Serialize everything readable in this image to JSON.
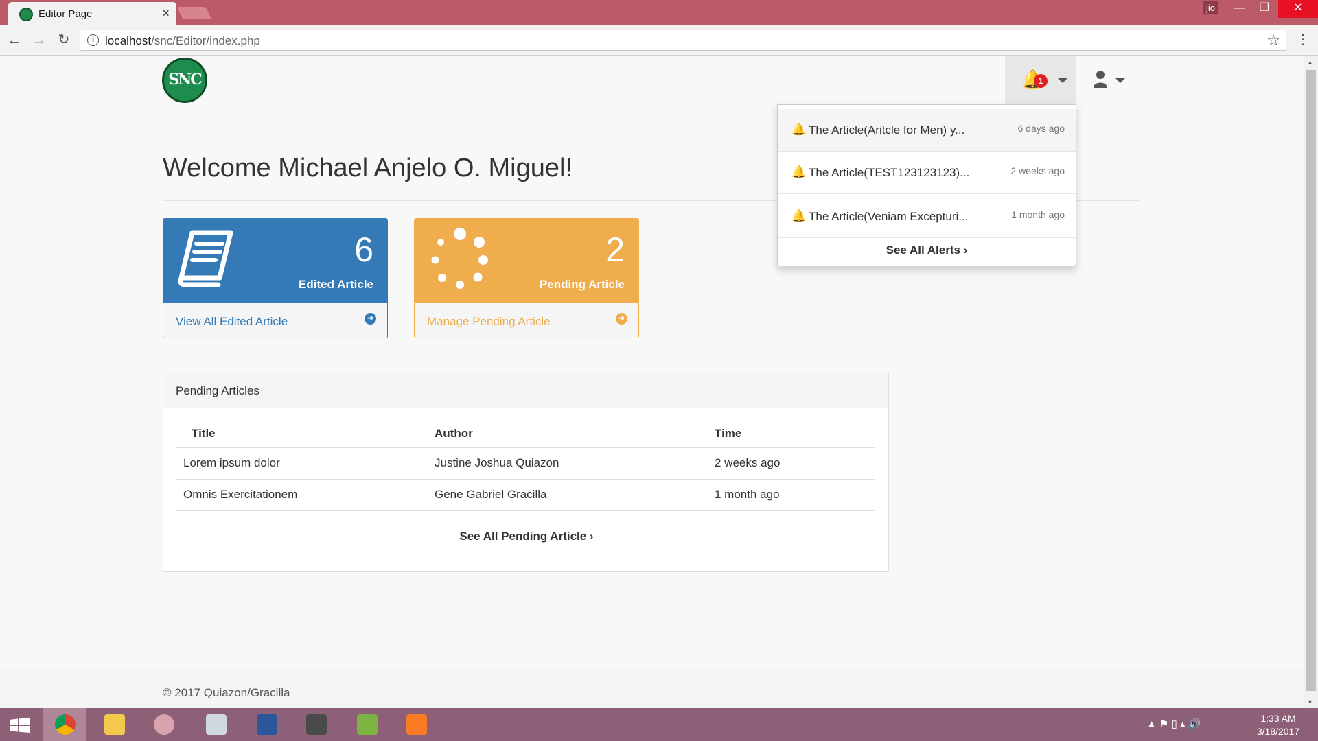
{
  "browser": {
    "tab_title": "Editor Page",
    "tab_close": "×",
    "window_user": "jio",
    "url_host": "localhost",
    "url_path": "/snc/Editor/index.php"
  },
  "navbar": {
    "logo_text": "SNC",
    "notification_count": "1"
  },
  "page": {
    "welcome": "Welcome Michael Anjelo O. Miguel!"
  },
  "cards": {
    "edited": {
      "count": "6",
      "label": "Edited Article",
      "link": "View All Edited Article"
    },
    "pending": {
      "count": "2",
      "label": "Pending Article",
      "link": "Manage Pending Article"
    }
  },
  "pending_table": {
    "heading": "Pending Articles",
    "columns": [
      "Title",
      "Author",
      "Time"
    ],
    "rows": [
      {
        "title": "Lorem ipsum dolor",
        "author": "Justine Joshua Quiazon",
        "time": "2 weeks ago"
      },
      {
        "title": "Omnis Exercitationem",
        "author": "Gene Gabriel Gracilla",
        "time": "1 month ago"
      }
    ],
    "see_all": "See All Pending Article ›"
  },
  "alerts": {
    "items": [
      {
        "text": "The Article(Aritcle for Men) y...",
        "time": "6 days ago"
      },
      {
        "text": "The Article(TEST123123123)...",
        "time": "2 weeks ago"
      },
      {
        "text": "The Article(Veniam Excepturi...",
        "time": "1 month ago"
      }
    ],
    "see_all": "See All Alerts ›"
  },
  "footer": {
    "text": "©  2017 Quiazon/Gracilla"
  },
  "taskbar": {
    "time": "1:33 AM",
    "date": "3/18/2017"
  },
  "colors": {
    "primary": "#337ab7",
    "warning": "#f0ad4e",
    "badge": "#e02020"
  }
}
